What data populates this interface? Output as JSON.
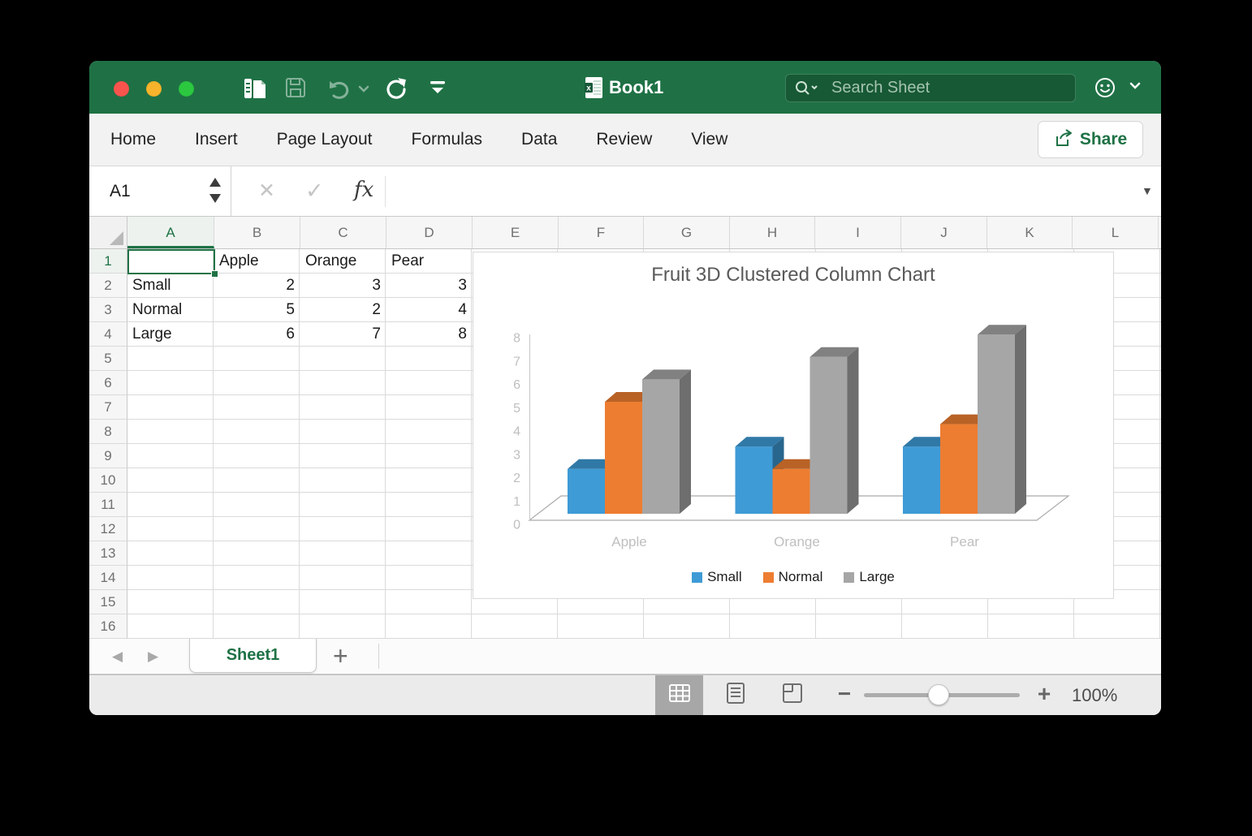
{
  "titlebar": {
    "title": "Book1",
    "search_placeholder": "Search Sheet",
    "toolbar_icons": [
      "panel-new-sheet-icon",
      "save-icon",
      "undo-icon",
      "undo-chevron-icon",
      "redo-icon",
      "customize-toolbar-icon"
    ],
    "right_icons": [
      "feedback-smiley-icon",
      "chevron-down-icon"
    ]
  },
  "ribbon": {
    "tabs": [
      "Home",
      "Insert",
      "Page Layout",
      "Formulas",
      "Data",
      "Review",
      "View"
    ],
    "share_label": "Share",
    "share_icon": "share-arrow-icon",
    "accent_color": "#1E7245"
  },
  "formula_bar": {
    "name_box_value": "A1",
    "cancel_glyph": "✕",
    "enter_glyph": "✓",
    "fx_label": "fx",
    "expand_glyph": "▼"
  },
  "sheet": {
    "column_headers": [
      "A",
      "B",
      "C",
      "D",
      "E",
      "F",
      "G",
      "H",
      "I",
      "J",
      "K",
      "L"
    ],
    "row_headers": [
      "1",
      "2",
      "3",
      "4",
      "5",
      "6",
      "7",
      "8",
      "9",
      "10",
      "11",
      "12",
      "13",
      "14",
      "15",
      "16"
    ],
    "selected_cell": "A1",
    "selected_column": "A",
    "selected_row": "1",
    "cells": [
      {
        "ref": "B1",
        "col": 1,
        "row": 0,
        "text": "Apple",
        "align": "left"
      },
      {
        "ref": "C1",
        "col": 2,
        "row": 0,
        "text": "Orange",
        "align": "left"
      },
      {
        "ref": "D1",
        "col": 3,
        "row": 0,
        "text": "Pear",
        "align": "left"
      },
      {
        "ref": "A2",
        "col": 0,
        "row": 1,
        "text": "Small",
        "align": "left"
      },
      {
        "ref": "B2",
        "col": 1,
        "row": 1,
        "text": "2",
        "align": "right"
      },
      {
        "ref": "C2",
        "col": 2,
        "row": 1,
        "text": "3",
        "align": "right"
      },
      {
        "ref": "D2",
        "col": 3,
        "row": 1,
        "text": "3",
        "align": "right"
      },
      {
        "ref": "A3",
        "col": 0,
        "row": 2,
        "text": "Normal",
        "align": "left"
      },
      {
        "ref": "B3",
        "col": 1,
        "row": 2,
        "text": "5",
        "align": "right"
      },
      {
        "ref": "C3",
        "col": 2,
        "row": 2,
        "text": "2",
        "align": "right"
      },
      {
        "ref": "D3",
        "col": 3,
        "row": 2,
        "text": "4",
        "align": "right"
      },
      {
        "ref": "A4",
        "col": 0,
        "row": 3,
        "text": "Large",
        "align": "left"
      },
      {
        "ref": "B4",
        "col": 1,
        "row": 3,
        "text": "6",
        "align": "right"
      },
      {
        "ref": "C4",
        "col": 2,
        "row": 3,
        "text": "7",
        "align": "right"
      },
      {
        "ref": "D4",
        "col": 3,
        "row": 3,
        "text": "8",
        "align": "right"
      }
    ]
  },
  "chart_data": {
    "type": "bar",
    "subtype": "3d-clustered-column",
    "title": "Fruit 3D Clustered Column Chart",
    "categories": [
      "Apple",
      "Orange",
      "Pear"
    ],
    "series": [
      {
        "name": "Small",
        "color": "#3E9BD6",
        "values": [
          2,
          3,
          3
        ]
      },
      {
        "name": "Normal",
        "color": "#ED7D31",
        "values": [
          5,
          2,
          4
        ]
      },
      {
        "name": "Large",
        "color": "#A6A6A6",
        "values": [
          6,
          7,
          8
        ]
      }
    ],
    "ylim": [
      0,
      8
    ],
    "yticks": [
      "0",
      "1",
      "2",
      "3",
      "4",
      "5",
      "6",
      "7",
      "8"
    ],
    "legend_position": "bottom",
    "gridlines": false,
    "axis_text_color": "#BFBFBF",
    "title_color": "#595959"
  },
  "sheet_tabs": {
    "tabs": [
      "Sheet1"
    ],
    "active_tab": "Sheet1",
    "add_label": "+",
    "nav_icons": [
      "scroll-left-icon",
      "scroll-right-icon"
    ]
  },
  "status_bar": {
    "view_icons": [
      "normal-view-icon",
      "page-layout-view-icon",
      "page-break-view-icon"
    ],
    "zoom_out_glyph": "−",
    "zoom_in_glyph": "+",
    "zoom_level": "100%"
  }
}
